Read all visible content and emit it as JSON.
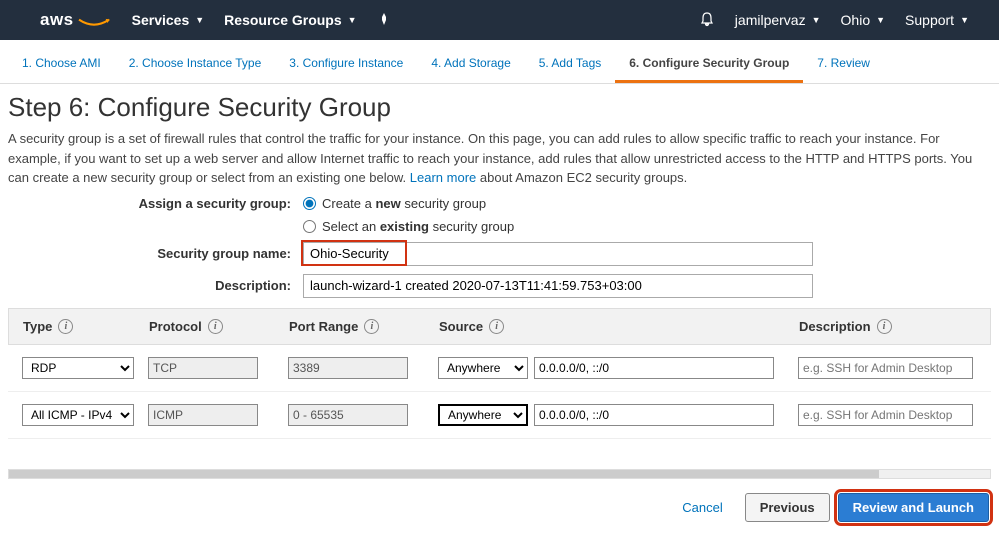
{
  "topnav": {
    "services": "Services",
    "resource_groups": "Resource Groups",
    "user": "jamilpervaz",
    "region": "Ohio",
    "support": "Support"
  },
  "tabs": [
    "1. Choose AMI",
    "2. Choose Instance Type",
    "3. Configure Instance",
    "4. Add Storage",
    "5. Add Tags",
    "6. Configure Security Group",
    "7. Review"
  ],
  "heading": "Step 6: Configure Security Group",
  "description_1": "A security group is a set of firewall rules that control the traffic for your instance. On this page, you can add rules to allow specific traffic to reach your instance. For example, if you want to set up a web server and allow Internet traffic to reach your instance, add rules that allow unrestricted access to the HTTP and HTTPS ports. You can create a new security group or select from an existing one below. ",
  "learn_more": "Learn more",
  "description_2": " about Amazon EC2 security groups.",
  "form": {
    "assign_label": "Assign a security group:",
    "create_prefix": "Create a ",
    "create_bold": "new",
    "create_suffix": " security group",
    "select_prefix": "Select an ",
    "select_bold": "existing",
    "select_suffix": " security group",
    "name_label": "Security group name:",
    "name_value": "Ohio-Security",
    "desc_label": "Description:",
    "desc_value": "launch-wizard-1 created 2020-07-13T11:41:59.753+03:00"
  },
  "headers": {
    "type": "Type",
    "protocol": "Protocol",
    "port": "Port Range",
    "source": "Source",
    "description": "Description"
  },
  "rules": [
    {
      "type": "RDP",
      "protocol": "TCP",
      "port": "3389",
      "source_sel": "Anywhere",
      "source_val": "0.0.0.0/0, ::/0",
      "desc_ph": "e.g. SSH for Admin Desktop",
      "src_hl": false
    },
    {
      "type": "All ICMP - IPv4",
      "protocol": "ICMP",
      "port": "0 - 65535",
      "source_sel": "Anywhere",
      "source_val": "0.0.0.0/0, ::/0",
      "desc_ph": "e.g. SSH for Admin Desktop",
      "src_hl": true
    }
  ],
  "footer": {
    "cancel": "Cancel",
    "previous": "Previous",
    "review": "Review and Launch"
  }
}
